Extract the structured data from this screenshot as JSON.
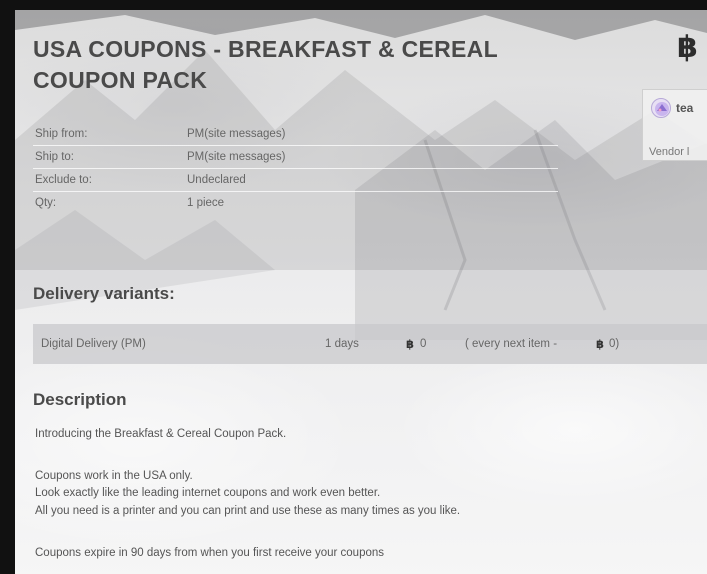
{
  "product": {
    "title": "USA COUPONS - BREAKFAST & CEREAL COUPON PACK",
    "currency_symbol": "฿"
  },
  "vendor": {
    "name": "tea",
    "label": "Vendor l"
  },
  "info": [
    {
      "key": "Ship from:",
      "value": "PM(site messages)"
    },
    {
      "key": "Ship to:",
      "value": "PM(site messages)"
    },
    {
      "key": "Exclude to:",
      "value": "Undeclared"
    },
    {
      "key": "Qty:",
      "value": "1 piece"
    }
  ],
  "delivery": {
    "heading": "Delivery variants:",
    "variants": [
      {
        "name": "Digital Delivery (PM)",
        "days": "1 days",
        "currency": "฿",
        "price": "0",
        "next_prefix": "( every next item -",
        "next_currency": "฿",
        "next_suffix": "0)"
      }
    ]
  },
  "description": {
    "heading": "Description",
    "lines": [
      "Introducing the Breakfast & Cereal Coupon Pack.",
      "Coupons work in the USA only.",
      "Look exactly like the leading internet coupons and work even better.",
      "All you need is a printer and you can print and use these as many times as you like.",
      "Coupons expire in 90 days from when you first receive your coupons"
    ]
  },
  "colors": {
    "text": "#4a4a4a",
    "muted": "#666666",
    "delivery_bar": "#c8c8ca",
    "frame": "#111111"
  }
}
